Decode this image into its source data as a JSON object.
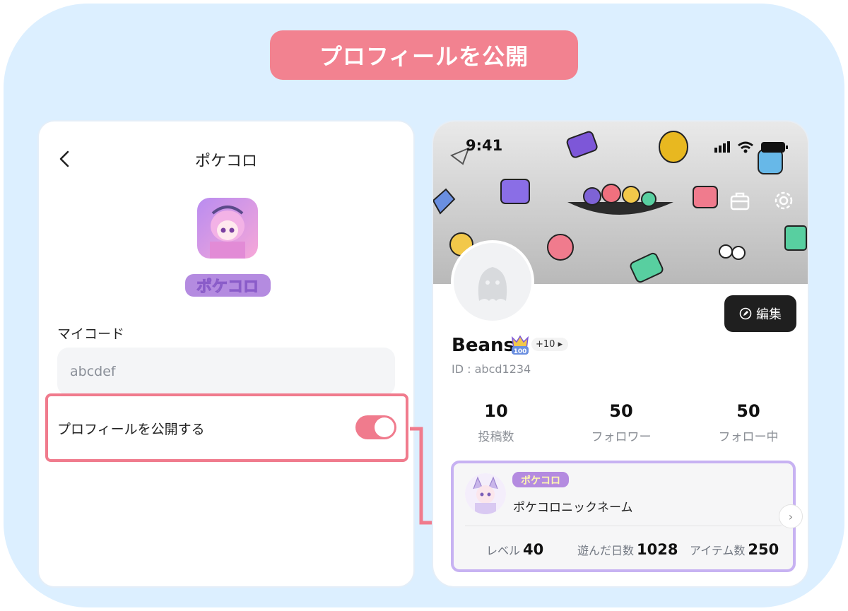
{
  "banner": {
    "text": "プロフィールを公開"
  },
  "left_screen": {
    "back_icon": "chevron-left-icon",
    "title": "ポケコロ",
    "app_logo_text": "ポケコロ",
    "my_code": {
      "label": "マイコード",
      "value": "abcdef"
    },
    "public_profile": {
      "label": "プロフィールを公開する",
      "enabled": true
    }
  },
  "right_screen": {
    "status_bar": {
      "time": "9:41"
    },
    "edit_button": "編集",
    "profile": {
      "name": "Beans",
      "badge_level": "100",
      "badge_extra": "+10",
      "id": "ID : abcd1234"
    },
    "stats": [
      {
        "value": "10",
        "label": "投稿数"
      },
      {
        "value": "50",
        "label": "フォロワー"
      },
      {
        "value": "50",
        "label": "フォロー中"
      }
    ],
    "game_card": {
      "game_logo_text": "ポケコロ",
      "nickname": "ポケコロニックネーム",
      "level": {
        "label": "レベル",
        "value": "40"
      },
      "days": {
        "label": "遊んだ日数",
        "value": "1028"
      },
      "items": {
        "label": "アイテム数",
        "value": "250"
      }
    }
  },
  "colors": {
    "accent_pink": "#f07b8d",
    "card_border": "#c7b2f2",
    "background": "#dcefff"
  }
}
